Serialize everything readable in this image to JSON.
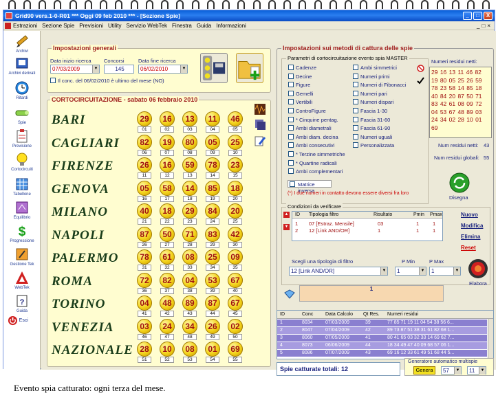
{
  "window": {
    "title": "Grid90 vers.1-0-R01   ***  Oggi 09 feb 2010  ***  - [Sezione Spie]",
    "min": "_",
    "max": "□",
    "close": "X"
  },
  "menu": {
    "items": [
      "Estrazioni",
      "Sezione Spie",
      "Previsioni",
      "Utility",
      "Servizio WebTek",
      "Finestra",
      "Guida",
      "Informazioni"
    ],
    "mdi": [
      "_",
      "□",
      "×"
    ]
  },
  "sidebar": {
    "items": [
      "Archivi",
      "Archivi derivati",
      "Ritardi",
      "Spie",
      "Previsione",
      "Cortocircuiti",
      "Tabellone",
      "Equilibrio",
      "Progressione",
      "Gestione Tek",
      "WebTek",
      "Guida",
      "Esci"
    ]
  },
  "general": {
    "title": "Impostazioni generali",
    "start_label": "Data inizio ricerca",
    "start_value": "07/03/2009",
    "contests_label": "Concorsi",
    "contests_value": "145",
    "end_label": "Data fine ricerca",
    "end_value": "06/02/2010",
    "checkbox_label": "Il conc. del 06/02/2010 è ultimo del mese (NO)"
  },
  "corto": {
    "title": "CORTOCIRCUITAZIONE - sabato 06 febbraio 2010",
    "wheels": [
      {
        "name": "BARI",
        "nums": [
          "29",
          "16",
          "13",
          "11",
          "46"
        ],
        "pos": [
          "01",
          "02",
          "03",
          "04",
          "05"
        ]
      },
      {
        "name": "CAGLIARI",
        "nums": [
          "82",
          "19",
          "80",
          "05",
          "25"
        ],
        "pos": [
          "06",
          "07",
          "08",
          "09",
          "10"
        ]
      },
      {
        "name": "FIRENZE",
        "nums": [
          "26",
          "16",
          "59",
          "78",
          "23"
        ],
        "pos": [
          "11",
          "12",
          "13",
          "14",
          "15"
        ]
      },
      {
        "name": "GENOVA",
        "nums": [
          "05",
          "58",
          "14",
          "85",
          "18"
        ],
        "pos": [
          "16",
          "17",
          "18",
          "19",
          "20"
        ]
      },
      {
        "name": "MILANO",
        "nums": [
          "40",
          "18",
          "29",
          "84",
          "20"
        ],
        "pos": [
          "21",
          "22",
          "23",
          "24",
          "25"
        ]
      },
      {
        "name": "NAPOLI",
        "nums": [
          "87",
          "50",
          "71",
          "83",
          "42"
        ],
        "pos": [
          "26",
          "27",
          "28",
          "29",
          "30"
        ]
      },
      {
        "name": "PALERMO",
        "nums": [
          "78",
          "61",
          "08",
          "25",
          "09"
        ],
        "pos": [
          "31",
          "32",
          "33",
          "34",
          "35"
        ]
      },
      {
        "name": "ROMA",
        "nums": [
          "72",
          "82",
          "04",
          "53",
          "67"
        ],
        "pos": [
          "36",
          "37",
          "38",
          "39",
          "40"
        ]
      },
      {
        "name": "TORINO",
        "nums": [
          "04",
          "48",
          "89",
          "87",
          "67"
        ],
        "pos": [
          "41",
          "42",
          "43",
          "44",
          "45"
        ]
      },
      {
        "name": "VENEZIA",
        "nums": [
          "03",
          "24",
          "34",
          "26",
          "02"
        ],
        "pos": [
          "46",
          "47",
          "48",
          "49",
          "50"
        ]
      },
      {
        "name": "NAZIONALE",
        "nums": [
          "28",
          "10",
          "08",
          "01",
          "69"
        ],
        "pos": [
          "51",
          "52",
          "53",
          "54",
          "55"
        ]
      }
    ]
  },
  "metodi": {
    "title": "Impostazioni sui metodi di cattura delle spie",
    "params_title": "Parametri di cortocircuitazione evento spia MASTER",
    "col1": [
      "Cadenze",
      "Decine",
      "Figure",
      "Gemelli",
      "Vertibili",
      "ControFigure",
      "* Cinquine pentag.",
      "Ambi diametrali",
      "Ambi diam. decina",
      "Ambi consecutivi",
      "* Terzine simmetriche",
      "* Quartine radicali",
      "Ambi complementari"
    ],
    "col2": [
      "Ambi simmetrici",
      "Numeri primi",
      "Numeri di Fibonacci",
      "Numeri pari",
      "Numeri dispari",
      "Fascia 1-30",
      "Fascia 31-60",
      "Fascia 61-90",
      "Numeri uguali",
      "Personalizzata"
    ],
    "matrice": "Matrice inversa",
    "note": "(*) I due numeri in contatto devono essere diversi fra loro",
    "numres_title": "Numeri residui netti:",
    "numres_text": "29 16 13 11 46 82 19 80 05 25 26 59 78 23 58 14 85 18 40 84 20 87 50 71 83 42 61 08 09 72 04 53 67 48 89 03 24 34 02 28 10 01 69",
    "netti_label": "Num residui netti:",
    "netti_value": "43",
    "globali_label": "Num residui globali:",
    "globali_value": "55",
    "disegna": "Disegna"
  },
  "cond": {
    "title": "Condizioni da verificare",
    "headers": [
      "ID",
      "Tipologia filtro",
      "Risultato",
      "Pmin",
      "Pmax"
    ],
    "rows": [
      [
        "1",
        "07 [Estraz. Mensile]",
        "03",
        "1",
        "1"
      ],
      [
        "2",
        "12 [Link AND/OR]",
        "1",
        "1",
        "1"
      ]
    ],
    "links": [
      "Nuovo",
      "Modifica",
      "Elimina",
      "Reset"
    ],
    "choose_label": "Scegli una tipologia di filtro",
    "pmin_label": "P Min",
    "pmax_label": "P Max",
    "filter_value": "12 [Link AND/OR]",
    "pmin_value": "1",
    "pmax_value": "1",
    "result_value": "1",
    "elabora": "Elabora"
  },
  "results": {
    "headers": [
      "ID",
      "Conc",
      "Data Calcolo",
      "Qt Res.",
      "Numeri residui"
    ],
    "rows": [
      [
        "1",
        "8034",
        "07/03/2009",
        "39",
        "77 85 71 19 11 04 54 38 56 6..."
      ],
      [
        "2",
        "8047",
        "07/04/2009",
        "42",
        "89 73 87 51 38 31 61 82 68 1..."
      ],
      [
        "3",
        "8060",
        "07/05/2009",
        "41",
        "80 41 65 03 32 33 14 69 62 7..."
      ],
      [
        "4",
        "8073",
        "06/06/2009",
        "44",
        "18 34 49 47 40 09 68 57 06 1..."
      ],
      [
        "5",
        "8086",
        "07/07/2009",
        "43",
        "69 16 12 33 61 49 51 68 44 5..."
      ]
    ],
    "total": "Spie catturate totali: 12"
  },
  "generator": {
    "title": "Generatore automatico multispie",
    "button": "Genera",
    "v1": "57",
    "v2": "11"
  },
  "caption": "Evento spia catturato: ogni terza del mese."
}
